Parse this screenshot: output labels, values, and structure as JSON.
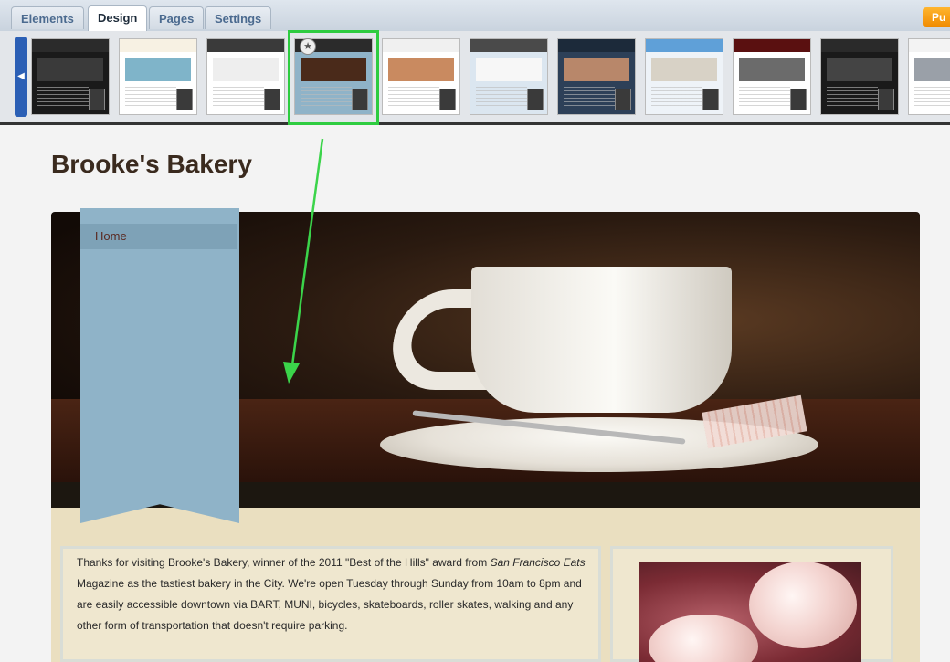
{
  "tabs": [
    {
      "label": "Elements",
      "active": false
    },
    {
      "label": "Design",
      "active": true
    },
    {
      "label": "Pages",
      "active": false
    },
    {
      "label": "Settings",
      "active": false
    }
  ],
  "publish_button": {
    "label": "Pu"
  },
  "theme_strip": {
    "scroll_left_icon": "chevron-left-icon",
    "selected_index": 3,
    "selected_icon": "star-icon",
    "themes": [
      {
        "head": "#2b2b2b",
        "body": "#1a1a1a",
        "img": "#3a3a3a"
      },
      {
        "head": "#f7f1e3",
        "body": "#ffffff",
        "img": "#7fb4c9"
      },
      {
        "head": "#3a3a3a",
        "body": "#ffffff",
        "img": "#eeeeee"
      },
      {
        "head": "#2b2b2b",
        "body": "#8fb3c8",
        "img": "#4a2a1a"
      },
      {
        "head": "#f0f0f0",
        "body": "#ffffff",
        "img": "#c98a60"
      },
      {
        "head": "#4a4a4a",
        "body": "#dbe6f0",
        "img": "#f7f7f7"
      },
      {
        "head": "#1c2a3a",
        "body": "#2d4058",
        "img": "#b8876a"
      },
      {
        "head": "#5fa0d8",
        "body": "#eef3f8",
        "img": "#d8d2c6"
      },
      {
        "head": "#5a1010",
        "body": "#ffffff",
        "img": "#6b6b6b"
      },
      {
        "head": "#2a2a2a",
        "body": "#1a1a1a",
        "img": "#444444"
      },
      {
        "head": "#f3f3f3",
        "body": "#ffffff",
        "img": "#9aa0a8"
      }
    ]
  },
  "site": {
    "title": "Brooke's Bakery",
    "nav": [
      {
        "label": "Home"
      }
    ],
    "body_parts": [
      "Thanks for visiting Brooke's Bakery, winner of the 2011 \"Best of the Hills\" award from ",
      "San Francisco Eats",
      " Magazine as the tastiest bakery in the City.  We're open Tuesday through Sunday from 10am to 8pm and are easily accessible downtown via BART, MUNI, bicycles, skateboards, roller skates, walking and any other form of transportation that doesn't require parking."
    ]
  },
  "colors": {
    "accent_green": "#2ecc40",
    "ribbon_blue": "#8fb3c8",
    "tab_blue": "#4b6a8f"
  }
}
